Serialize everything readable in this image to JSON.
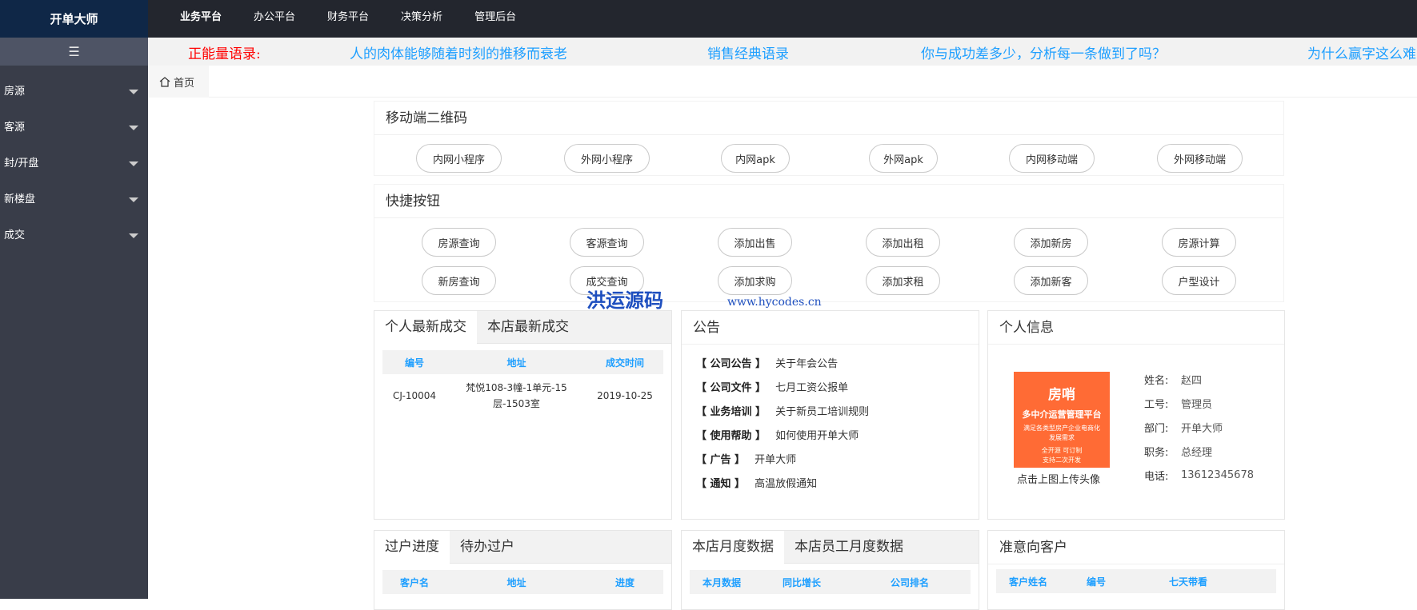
{
  "brand": "开单大师",
  "topnav": [
    "业务平台",
    "办公平台",
    "财务平台",
    "决策分析",
    "管理后台"
  ],
  "sidebar": {
    "toggle_icon": "menu-icon",
    "items": [
      "房源",
      "客源",
      "封/开盘",
      "新楼盘",
      "成交"
    ]
  },
  "marquee": {
    "label": "正能量语录:",
    "items": [
      "人的肉体能够随着时刻的推移而衰老",
      "销售经典语录",
      "你与成功差多少，分析每一条做到了吗？",
      "为什么赢字这么难"
    ]
  },
  "tabbar": {
    "home": "首页"
  },
  "qrcode": {
    "title": "移动端二维码",
    "buttons": [
      "内网小程序",
      "外网小程序",
      "内网apk",
      "外网apk",
      "内网移动端",
      "外网移动端"
    ]
  },
  "quick": {
    "title": "快捷按钮",
    "row1": [
      "房源查询",
      "客源查询",
      "添加出售",
      "添加出租",
      "添加新房",
      "房源计算"
    ],
    "row2": [
      "新房查询",
      "成交查询",
      "添加求购",
      "添加求租",
      "添加新客",
      "户型设计"
    ]
  },
  "watermark": {
    "text": "洪运源码",
    "url": "www.hycodes.cn"
  },
  "deals": {
    "tabs": [
      "个人最新成交",
      "本店最新成交"
    ],
    "columns": [
      "编号",
      "地址",
      "成交时间"
    ],
    "rows": [
      {
        "id": "CJ-10004",
        "addr1": "梵悦108-3幢-1单元-15",
        "addr2": "层-1503室",
        "date": "2019-10-25"
      }
    ]
  },
  "notice": {
    "title": "公告",
    "items": [
      {
        "tag": "【 公司公告 】",
        "text": "关于年会公告"
      },
      {
        "tag": "【 公司文件 】",
        "text": "七月工资公报单"
      },
      {
        "tag": "【 业务培训 】",
        "text": "关于新员工培训规则"
      },
      {
        "tag": "【 使用帮助 】",
        "text": "如何使用开单大师"
      },
      {
        "tag": "【 广告 】",
        "text": "开单大师"
      },
      {
        "tag": "【 通知 】",
        "text": "高温放假通知"
      }
    ]
  },
  "profile": {
    "title": "个人信息",
    "avatar": {
      "line1": "房哨",
      "line2": "多中介运营管理平台",
      "line3": "满足各类型房产企业电商化",
      "line4": "发展需求",
      "line5": "全开源 可订制",
      "line6": "支持二次开发"
    },
    "upload_hint": "点击上图上传头像",
    "fields": [
      {
        "k": "姓名:",
        "v": "赵四"
      },
      {
        "k": "工号:",
        "v": "管理员"
      },
      {
        "k": "部门:",
        "v": "开单大师"
      },
      {
        "k": "职务:",
        "v": "总经理"
      },
      {
        "k": "电话:",
        "v": "13612345678"
      }
    ]
  },
  "transfer": {
    "tabs": [
      "过户进度",
      "待办过户"
    ],
    "columns": [
      "客户名",
      "地址",
      "进度"
    ]
  },
  "monthly": {
    "tabs": [
      "本店月度数据",
      "本店员工月度数据"
    ],
    "columns": [
      "本月数据",
      "同比增长",
      "公司排名"
    ]
  },
  "intent": {
    "title": "准意向客户",
    "columns": [
      "客户姓名",
      "编号",
      "七天带看"
    ]
  }
}
